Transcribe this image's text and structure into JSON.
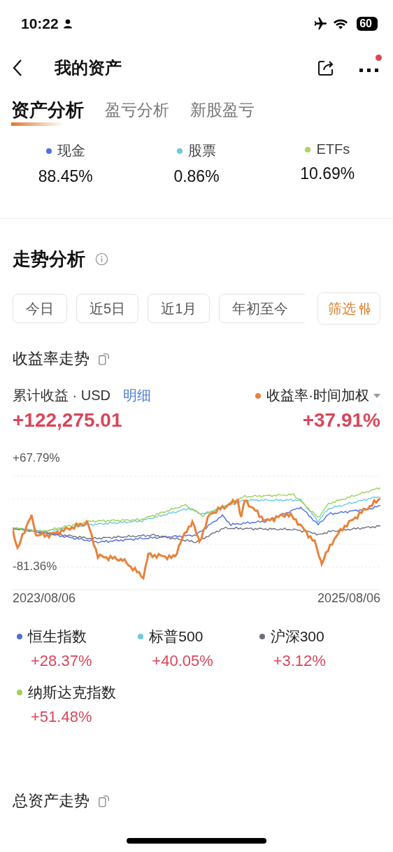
{
  "status_bar": {
    "time": "10:22",
    "battery": "60"
  },
  "nav": {
    "title": "我的资产",
    "notification_dot": true
  },
  "tabs": [
    {
      "label": "资产分析",
      "selected": true
    },
    {
      "label": "盈亏分析",
      "selected": false
    },
    {
      "label": "新股盈亏",
      "selected": false
    }
  ],
  "allocation": [
    {
      "label": "现金",
      "value": "88.45%",
      "color": "#5470e0"
    },
    {
      "label": "股票",
      "value": "0.86%",
      "color": "#6cc8e0"
    },
    {
      "label": "ETFs",
      "value": "10.69%",
      "color": "#a8d660"
    }
  ],
  "trend": {
    "title": "走势分析",
    "ranges": [
      {
        "label": "今日"
      },
      {
        "label": "近5日"
      },
      {
        "label": "近1月"
      },
      {
        "label": "年初至今"
      }
    ],
    "filter": "筛选"
  },
  "returns": {
    "title": "收益率走势",
    "cumulative_label": "累计收益 · USD",
    "detail_link": "明细",
    "cumulative_value": "+122,275.01",
    "rate_label": "收益率·时间加权",
    "rate_value": "+37.91%",
    "chart": {
      "y_max_label": "+67.79%",
      "y_min_label": "-81.36%",
      "x_start": "2023/08/06",
      "x_end": "2025/08/06"
    },
    "benchmarks": [
      {
        "name": "恒生指数",
        "value": "+28.37%",
        "color": "#4e6ee0"
      },
      {
        "name": "标普500",
        "value": "+40.05%",
        "color": "#6ccbe0"
      },
      {
        "name": "沪深300",
        "value": "+3.12%",
        "color": "#6b7080"
      },
      {
        "name": "纳斯达克指数",
        "value": "+51.48%",
        "color": "#9fd05a"
      }
    ]
  },
  "total_assets": {
    "title": "总资产走势"
  }
}
